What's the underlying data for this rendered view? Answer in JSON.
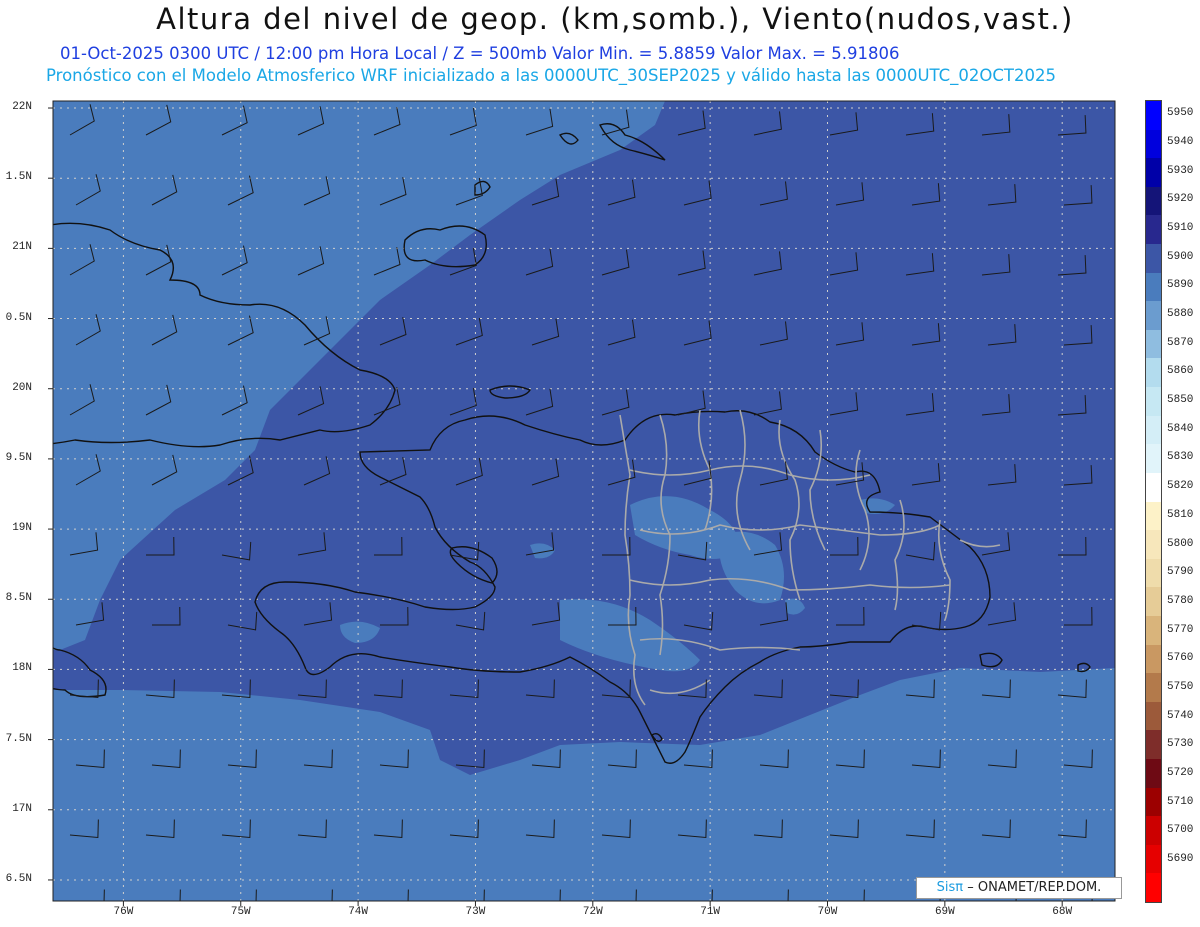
{
  "title": "Altura del nivel de geop. (km,somb.), Viento(nudos,vast.)",
  "subtitle": "01-Oct-2025  0300 UTC / 12:00 pm Hora Local / Z = 500mb    Valor Min. = 5.8859  Valor Max. = 5.91806",
  "forecast_line": "Pronóstico con el Modelo Atmosferico WRF inicializado a las 0000UTC_30SEP2025 y válido hasta las  0000UTC_02OCT2025",
  "credit": {
    "sis": "Sisπ",
    "rest": "– ONAMET/REP.DOM."
  },
  "colors": {
    "ocean_band": "#4a7cbd",
    "main_5900": "#3c56a6",
    "patch_5890": "#5589c5",
    "coast": "#111111",
    "province_border": "#aaaaaa",
    "grid": "#cfcfcf"
  },
  "map": {
    "lon_range": [
      -76.6,
      -67.55
    ],
    "lat_range": [
      16.35,
      22.05
    ],
    "lat_labels": [
      {
        "v": 22,
        "text": "22N"
      },
      {
        "v": 21.5,
        "text": "1.5N"
      },
      {
        "v": 21,
        "text": "21N"
      },
      {
        "v": 20.5,
        "text": "0.5N"
      },
      {
        "v": 20,
        "text": "20N"
      },
      {
        "v": 19.5,
        "text": "9.5N"
      },
      {
        "v": 19,
        "text": "19N"
      },
      {
        "v": 18.5,
        "text": "8.5N"
      },
      {
        "v": 18,
        "text": "18N"
      },
      {
        "v": 17.5,
        "text": "7.5N"
      },
      {
        "v": 17,
        "text": "17N"
      },
      {
        "v": 16.5,
        "text": "6.5N"
      }
    ],
    "lon_labels": [
      {
        "v": -76,
        "text": "76W"
      },
      {
        "v": -75,
        "text": "75W"
      },
      {
        "v": -74,
        "text": "74W"
      },
      {
        "v": -73,
        "text": "73W"
      },
      {
        "v": -72,
        "text": "72W"
      },
      {
        "v": -71,
        "text": "71W"
      },
      {
        "v": -70,
        "text": "70W"
      },
      {
        "v": -69,
        "text": "69W"
      },
      {
        "v": -68,
        "text": "68W"
      }
    ]
  },
  "colorbar": {
    "levels": [
      {
        "label": "5950",
        "color": "#0000ff"
      },
      {
        "label": "5940",
        "color": "#0000dd"
      },
      {
        "label": "5930",
        "color": "#0000a8"
      },
      {
        "label": "5920",
        "color": "#141478"
      },
      {
        "label": "5910",
        "color": "#28288e"
      },
      {
        "label": "5900",
        "color": "#3c56a6"
      },
      {
        "label": "5890",
        "color": "#4a7cbd"
      },
      {
        "label": "5880",
        "color": "#6b9ccf"
      },
      {
        "label": "5870",
        "color": "#8fbde0"
      },
      {
        "label": "5860",
        "color": "#b3dcee"
      },
      {
        "label": "5850",
        "color": "#c6e8f3"
      },
      {
        "label": "5840",
        "color": "#d4eef7"
      },
      {
        "label": "5830",
        "color": "#e1f4fa"
      },
      {
        "label": "5820",
        "color": "#ffffff"
      },
      {
        "label": "5810",
        "color": "#fdf2c8"
      },
      {
        "label": "5800",
        "color": "#f7e7bb"
      },
      {
        "label": "5790",
        "color": "#efdcab"
      },
      {
        "label": "5780",
        "color": "#e6cc97"
      },
      {
        "label": "5770",
        "color": "#d9b47b"
      },
      {
        "label": "5760",
        "color": "#c99862"
      },
      {
        "label": "5750",
        "color": "#b37a4b"
      },
      {
        "label": "5740",
        "color": "#9c5a3a"
      },
      {
        "label": "5730",
        "color": "#7e2d2a"
      },
      {
        "label": "5720",
        "color": "#6e0a14"
      },
      {
        "label": "5710",
        "color": "#9c0000"
      },
      {
        "label": "5700",
        "color": "#cc0000"
      },
      {
        "label": "5690",
        "color": "#e60000"
      },
      {
        "label": "",
        "color": "#ff0000"
      }
    ]
  }
}
